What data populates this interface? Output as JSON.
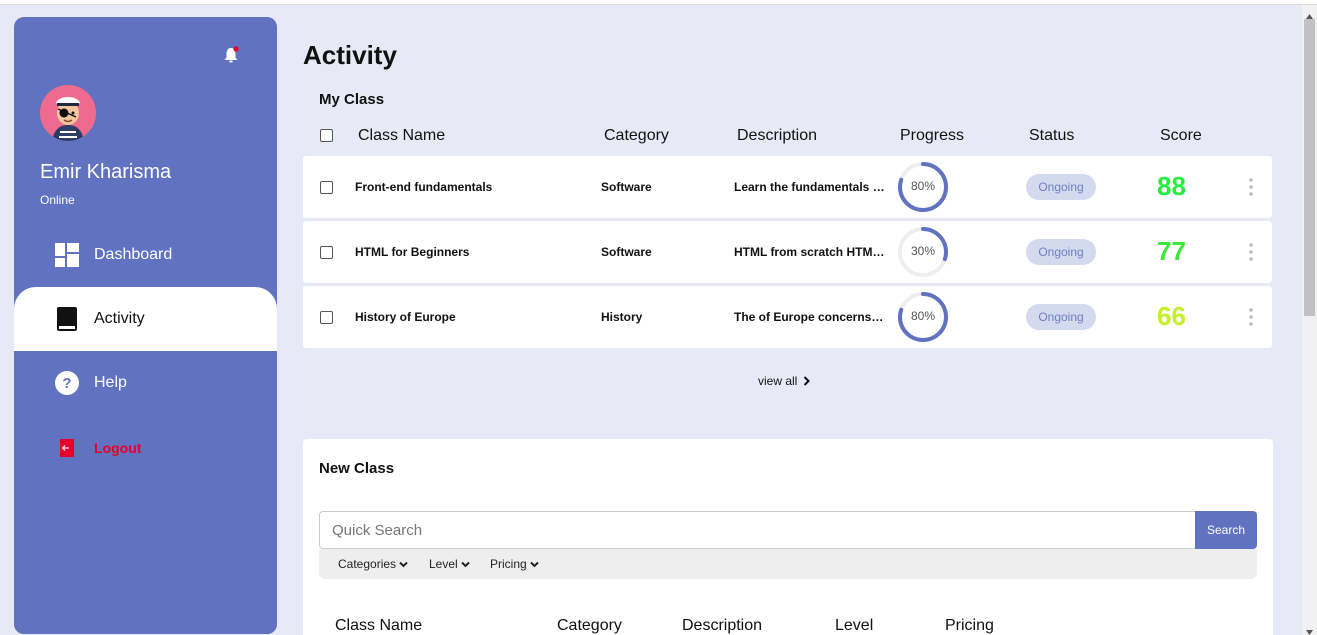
{
  "sidebar": {
    "user": {
      "name": "Emir Kharisma",
      "status": "Online"
    },
    "items": [
      {
        "label": "Dashboard",
        "icon": "dashboard-icon"
      },
      {
        "label": "Activity",
        "icon": "book-icon"
      },
      {
        "label": "Help",
        "icon": "help-icon"
      },
      {
        "label": "Logout",
        "icon": "logout-icon"
      }
    ]
  },
  "main": {
    "title": "Activity",
    "my_class": {
      "title": "My Class",
      "columns": [
        "Class Name",
        "Category",
        "Description",
        "Progress",
        "Status",
        "Score"
      ],
      "rows": [
        {
          "name": "Front-end fundamentals",
          "category": "Software",
          "description": "Learn the fundamentals of front-end development",
          "progress": 80,
          "progress_label": "80%",
          "status": "Ongoing",
          "score": "88",
          "score_color": "#22f03c"
        },
        {
          "name": "HTML for Beginners",
          "category": "Software",
          "description": "HTML from scratch HTML basics",
          "progress": 30,
          "progress_label": "30%",
          "status": "Ongoing",
          "score": "77",
          "score_color": "#3be83a"
        },
        {
          "name": "History of Europe",
          "category": "History",
          "description": "The of Europe concerns itself",
          "progress": 80,
          "progress_label": "80%",
          "status": "Ongoing",
          "score": "66",
          "score_color": "#c5ef2a"
        }
      ],
      "view_all": "view all"
    },
    "new_class": {
      "title": "New Class",
      "search_placeholder": "Quick Search",
      "search_button": "Search",
      "filters": [
        "Categories",
        "Level",
        "Pricing"
      ],
      "columns": [
        "Class Name",
        "Category",
        "Description",
        "Level",
        "Pricing"
      ]
    }
  },
  "colors": {
    "accent": "#6072c0",
    "background": "#e7eaf6",
    "logout": "#e8002a"
  }
}
